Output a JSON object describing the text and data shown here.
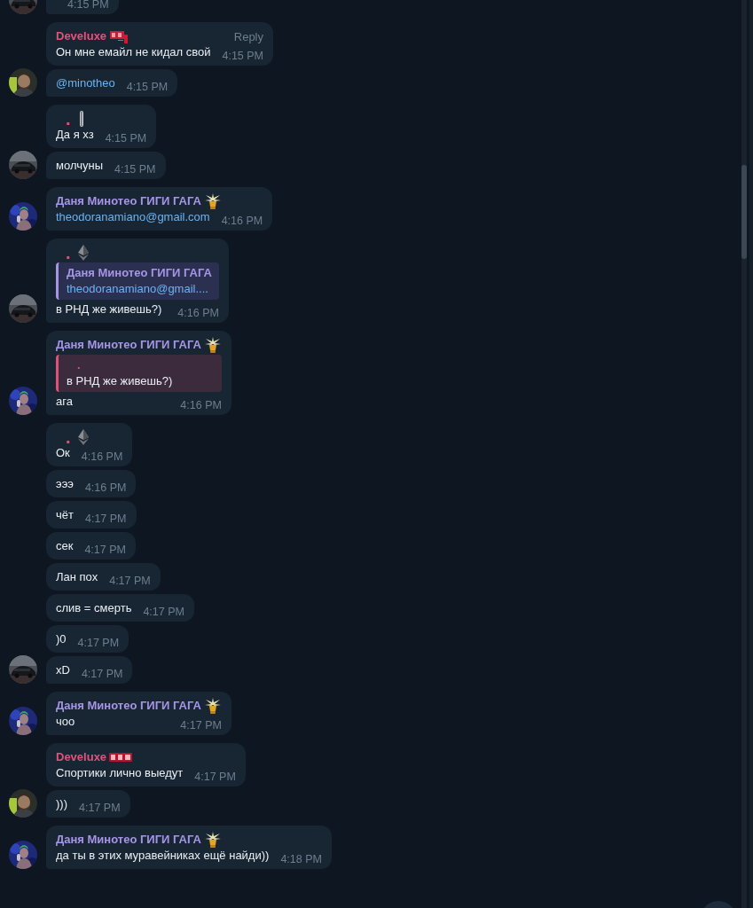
{
  "groups": [
    {
      "avatar": {
        "kind": "car"
      },
      "messages": [
        {
          "time": "4:15 PM"
        }
      ]
    },
    {
      "avatar": {
        "kind": "person"
      },
      "messages": [
        {
          "sender": {
            "name": "Develuxe",
            "color": "#e2527c",
            "badge": {
              "kind": "bu"
            }
          },
          "reply_label": "Reply",
          "text": "Он мне емайл не кидал свой",
          "link": false,
          "time": "4:15 PM"
        },
        {
          "text": "@minotheo",
          "link": true,
          "time": "4:15 PM"
        }
      ]
    },
    {
      "avatar": {
        "kind": "car"
      },
      "messages": [
        {
          "sender": {
            "name": ".",
            "color": "#e0517a",
            "badge": {
              "kind": "bar"
            }
          },
          "text": "Да я хз",
          "link": false,
          "time": "4:15 PM"
        },
        {
          "text": "молчуны",
          "link": false,
          "time": "4:15 PM"
        }
      ]
    },
    {
      "avatar": {
        "kind": "figure"
      },
      "messages": [
        {
          "sender": {
            "name": "Даня Минотео ГИГИ ГАГА",
            "color": "#a695e7",
            "badge": {
              "kind": "lamp"
            }
          },
          "text": "theodoranamiano@gmail.com",
          "link": true,
          "time": "4:16 PM"
        }
      ]
    },
    {
      "avatar": {
        "kind": "car"
      },
      "messages": [
        {
          "sender": {
            "name": ".",
            "color": "#e0517a",
            "badge": {
              "kind": "eth"
            }
          },
          "quote": {
            "name": "Даня Минотео ГИГИ ГАГА",
            "text": "theodoranamiano@gmail....",
            "color": "#a695e7",
            "link": true
          },
          "text": "в РНД же живешь?)",
          "link": false,
          "time": "4:16 PM"
        }
      ]
    },
    {
      "avatar": {
        "kind": "figure"
      },
      "messages": [
        {
          "sender": {
            "name": "Даня Минотео ГИГИ ГАГА",
            "color": "#a695e7",
            "badge": {
              "kind": "lamp"
            }
          },
          "quote": {
            "name": ".",
            "text": "в РНД же живешь?)",
            "color": "#e0517a",
            "link": false
          },
          "text": "ага",
          "link": false,
          "time": "4:16 PM"
        }
      ]
    },
    {
      "avatar": {
        "kind": "car"
      },
      "messages": [
        {
          "sender": {
            "name": ".",
            "color": "#e0517a",
            "badge": {
              "kind": "eth"
            }
          },
          "text": "Ок",
          "link": false,
          "time": "4:16 PM"
        },
        {
          "text": "эээ",
          "link": false,
          "time": "4:16 PM"
        },
        {
          "text": "чёт",
          "link": false,
          "time": "4:17 PM"
        },
        {
          "text": "сек",
          "link": false,
          "time": "4:17 PM"
        },
        {
          "text": "Лан пох",
          "link": false,
          "time": "4:17 PM"
        },
        {
          "text": "слив = смерть",
          "link": false,
          "time": "4:17 PM"
        },
        {
          "text": ")0",
          "link": false,
          "time": "4:17 PM"
        },
        {
          "text": "xD",
          "link": false,
          "time": "4:17 PM"
        }
      ]
    },
    {
      "avatar": {
        "kind": "figure"
      },
      "messages": [
        {
          "sender": {
            "name": "Даня Минотео ГИГИ ГАГА",
            "color": "#a695e7",
            "badge": {
              "kind": "lamp"
            }
          },
          "text": "чоо",
          "link": false,
          "time": "4:17 PM"
        }
      ]
    },
    {
      "avatar": {
        "kind": "person"
      },
      "messages": [
        {
          "sender": {
            "name": "Develuxe",
            "color": "#e2527c",
            "badge": {
              "kind": "bug"
            }
          },
          "text": "Спортики лично выедут",
          "link": false,
          "time": "4:17 PM"
        },
        {
          "text": ")))",
          "link": false,
          "time": "4:17 PM"
        }
      ]
    },
    {
      "avatar": {
        "kind": "figure"
      },
      "messages": [
        {
          "sender": {
            "name": "Даня Минотео ГИГИ ГАГА",
            "color": "#a695e7",
            "badge": {
              "kind": "lamp"
            }
          },
          "text": "да ты в этих муравейниках ещё найди))",
          "link": false,
          "time": "4:18 PM"
        }
      ]
    }
  ]
}
